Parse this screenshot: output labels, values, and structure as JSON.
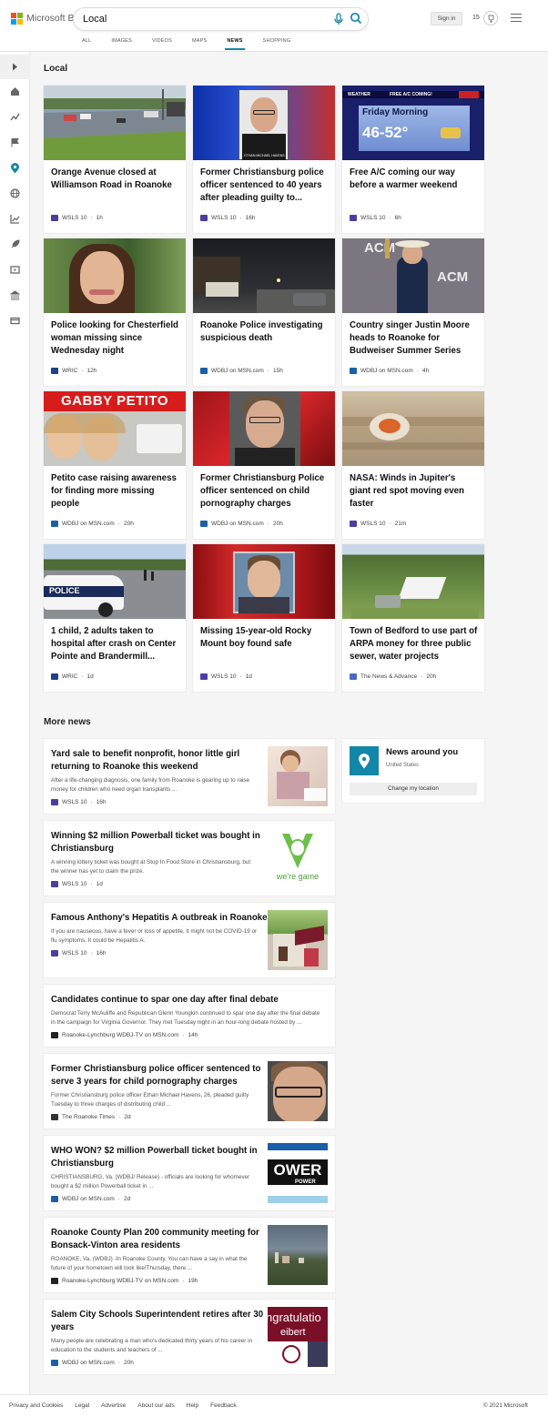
{
  "brand": {
    "name": "Microsoft Bing"
  },
  "search": {
    "query": "Local"
  },
  "header": {
    "sign_in": "Sign in",
    "rewards_count": "15"
  },
  "scopes": [
    "ALL",
    "IMAGES",
    "VIDEOS",
    "MAPS",
    "NEWS",
    "SHOPPING"
  ],
  "active_scope": "NEWS",
  "local": {
    "title": "Local",
    "cards": [
      {
        "title": "Orange Avenue closed at Williamson Road in Roanoke",
        "source": "WSLS 10",
        "age": "1h"
      },
      {
        "title": "Former Christiansburg police officer sentenced to 40 years after pleading guilty to...",
        "source": "WSLS 10",
        "age": "16h",
        "image_caption": "ETHAN MICHAEL HAVENS"
      },
      {
        "title": "Free A/C coming our way before a warmer weekend",
        "source": "WSLS 10",
        "age": "6h",
        "image_banner": "FREE A/C COMING!",
        "image_label": "WEATHER",
        "image_line1": "Friday Morning",
        "image_line2": "46-52°"
      },
      {
        "title": "Police looking for Chesterfield woman missing since Wednesday night",
        "source": "WRIC",
        "age": "12h"
      },
      {
        "title": "Roanoke Police investigating suspicious death",
        "source": "WDBJ on MSN.com",
        "age": "15h"
      },
      {
        "title": "Country singer Justin Moore heads to Roanoke for Budweiser Summer Series",
        "source": "WDBJ on MSN.com",
        "age": "4h",
        "image_text": "ACM"
      },
      {
        "title": "Petito case raising awareness for finding more missing people",
        "source": "WDBJ on MSN.com",
        "age": "20h",
        "image_banner": "GABBY PETITO"
      },
      {
        "title": "Former Christiansburg Police officer sentenced on child pornography charges",
        "source": "WDBJ on MSN.com",
        "age": "20h"
      },
      {
        "title": "NASA: Winds in Jupiter's giant red spot moving even faster",
        "source": "WSLS 10",
        "age": "21m"
      },
      {
        "title": "1 child, 2 adults taken to hospital after crash on Center Pointe and Brandermill...",
        "source": "WRIC",
        "age": "1d",
        "image_text": "POLICE"
      },
      {
        "title": "Missing 15-year-old Rocky Mount boy found safe",
        "source": "WSLS 10",
        "age": "1d"
      },
      {
        "title": "Town of Bedford to use part of ARPA money for three public sewer, water projects",
        "source": "The News & Advance",
        "age": "20h"
      }
    ]
  },
  "more_news": {
    "title": "More news",
    "items": [
      {
        "title_l1": "Yard sale to benefit nonprofit, honor little girl",
        "title_l2": "returning to Roanoke this weekend",
        "snip_l1": "After a life-changing diagnosis, one family from Roanoke is gearing up to raise",
        "snip_l2": "money for children who need organ transplants ...",
        "source": "WSLS 10",
        "age": "16h"
      },
      {
        "title_l1": "Winning $2 million Powerball ticket was bought in",
        "title_l2": "Christiansburg",
        "snip_l1": "A winning lottery ticket was bought at Stop In Food Store in Christiansburg, but",
        "snip_l2": "the winner has yet to claim the prize.",
        "source": "WSLS 10",
        "age": "1d",
        "thumb_text": "we're game"
      },
      {
        "title_l1": "Famous Anthony's Hepatitis A outbreak in Roanoke",
        "title_l2": "",
        "snip_l1": "If you are nauseous, have a fever or loss of appetite, it might not be COVID-19 or",
        "snip_l2": "flu symptoms. It could be Hepatitis A.",
        "source": "WSLS 10",
        "age": "16h"
      },
      {
        "title_l1": "Candidates continue to spar one day after final debate",
        "title_l2": "",
        "snip_l1": "Democrat Terry McAuliffe and Republican Glenn Youngkin continued to spar one day after the final debate",
        "snip_l2": "in the campaign for Virginia Governor. They met Tuesday night in an hour-long debate hosted by ...",
        "source": "Roanoke-Lynchburg WDBJ-TV on MSN.com",
        "age": "14h"
      },
      {
        "title_l1": "Former Christiansburg police officer sentenced to",
        "title_l2": "serve 3 years for child pornography charges",
        "snip_l1": "Former Christiansburg police officer Ethan Michael Havens, 26, pleaded guilty",
        "snip_l2": "Tuesday to three charges of distributing child ...",
        "source": "The Roanoke Times",
        "age": "2d"
      },
      {
        "title_l1": "WHO WON? $2 million Powerball ticket bought in",
        "title_l2": "Christiansburg",
        "snip_l1": "CHRISTIANSBURG, Va. (WDBJ/ Release) - officials are looking for whomever",
        "snip_l2": "bought a $2 million Powerball ticket in ...",
        "source": "WDBJ on MSN.com",
        "age": "2d",
        "thumb_text": "OWER",
        "thumb_sub": "POWER"
      },
      {
        "title_l1": "Roanoke County Plan 200 community meeting for",
        "title_l2": "Bonsack-Vinton area residents",
        "snip_l1": "ROANOKE, Va. (WDBJ) -In Roanoke County, You can have a say in what the",
        "snip_l2": "future of your hometown will look like!Thursday, there ...",
        "source": "Roanoke-Lynchburg WDBJ-TV on MSN.com",
        "age": "19h"
      },
      {
        "title_l1": "Salem City Schools Superintendent retires after 30",
        "title_l2": "years",
        "snip_l1": "Many people are celebrating a man who's dedicated thirty years of his career in",
        "snip_l2": "education to the students and teachers of ...",
        "source": "WDBJ on MSN.com",
        "age": "20h",
        "thumb_text": "ngratulatio",
        "thumb_sub": "eibert"
      }
    ]
  },
  "news_around_you": {
    "title": "News around you",
    "location": "United States",
    "button": "Change my location"
  },
  "footer": {
    "links": [
      "Privacy and Cookies",
      "Legal",
      "Advertise",
      "About our ads",
      "Help",
      "Feedback"
    ],
    "copyright": "© 2021 Microsoft"
  },
  "colors": {
    "accent": "#1486a8",
    "wsls": "#4b3ea0",
    "wric": "#1f3f8a",
    "wdbj": "#1b5fa7"
  }
}
